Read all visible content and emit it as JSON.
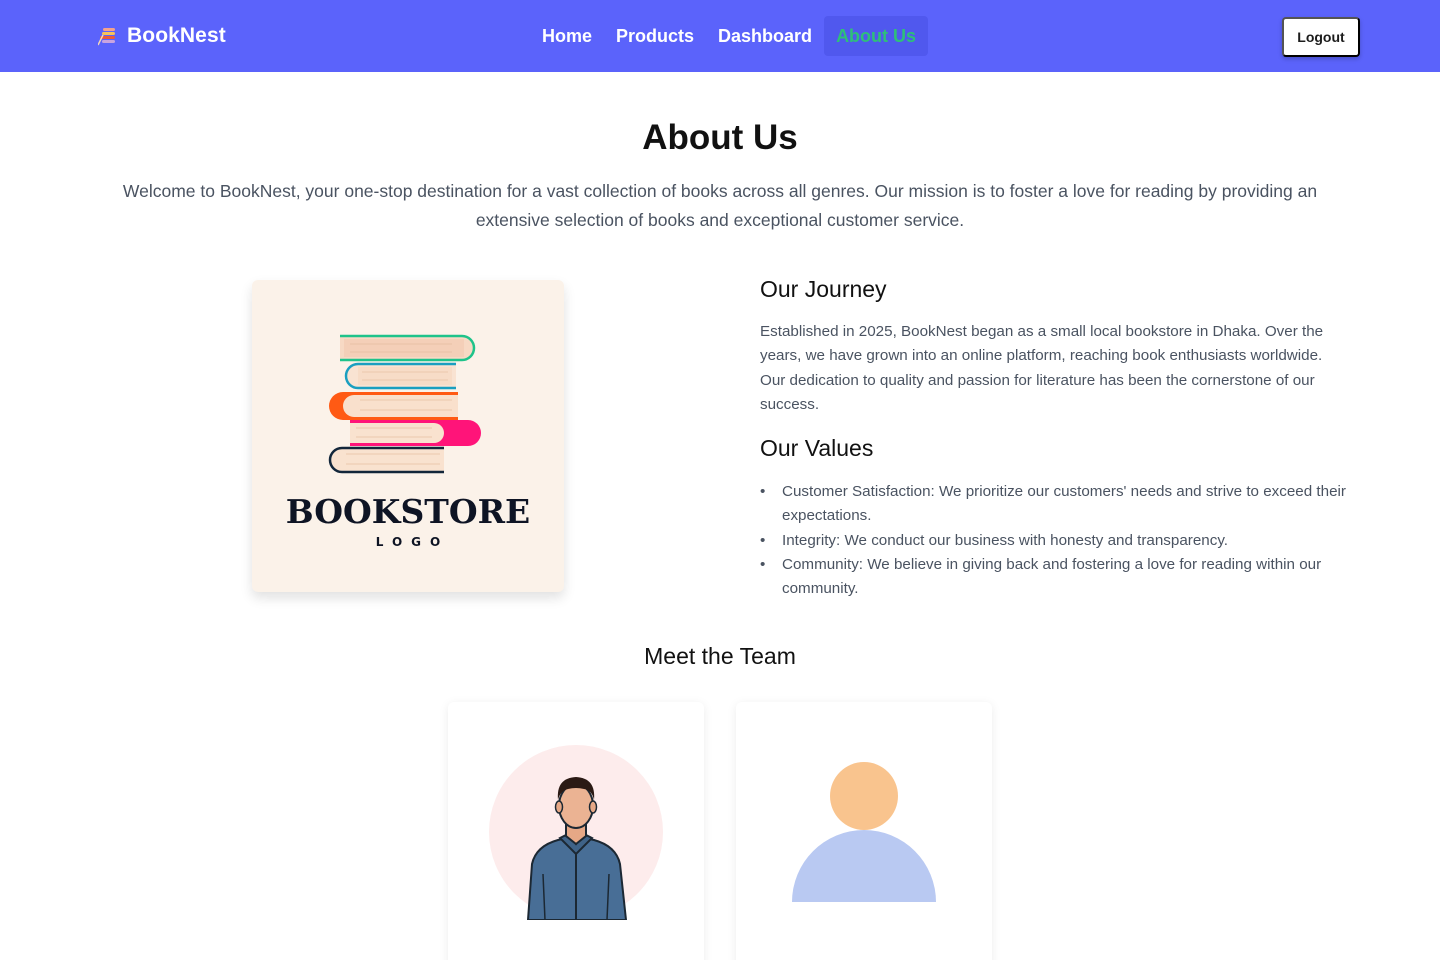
{
  "navbar": {
    "brand": "BookNest",
    "links": [
      {
        "label": "Home",
        "active": false
      },
      {
        "label": "Products",
        "active": false
      },
      {
        "label": "Dashboard",
        "active": false
      },
      {
        "label": "About Us",
        "active": true
      }
    ],
    "logout_label": "Logout"
  },
  "hero": {
    "title": "About Us",
    "intro": "Welcome to BookNest, your one-stop destination for a vast collection of books across all genres. Our mission is to foster a love for reading by providing an extensive selection of books and exceptional customer service."
  },
  "logo": {
    "title": "BOOKSTORE",
    "subtitle": "LOGO"
  },
  "journey": {
    "heading": "Our Journey",
    "text": "Established in 2025, BookNest began as a small local bookstore in Dhaka. Over the years, we have grown into an online platform, reaching book enthusiasts worldwide. Our dedication to quality and passion for literature has been the cornerstone of our success."
  },
  "values": {
    "heading": "Our Values",
    "items": [
      "Customer Satisfaction: We prioritize our customers' needs and strive to exceed their expectations.",
      "Integrity: We conduct our business with honesty and transparency.",
      "Community: We believe in giving back and fostering a love for reading within our community."
    ]
  },
  "team": {
    "heading": "Meet the Team"
  },
  "colors": {
    "navbar_bg": "#5b63fb",
    "active_link": "#2ebf7a",
    "logo_card_bg": "#fbf2e9"
  }
}
